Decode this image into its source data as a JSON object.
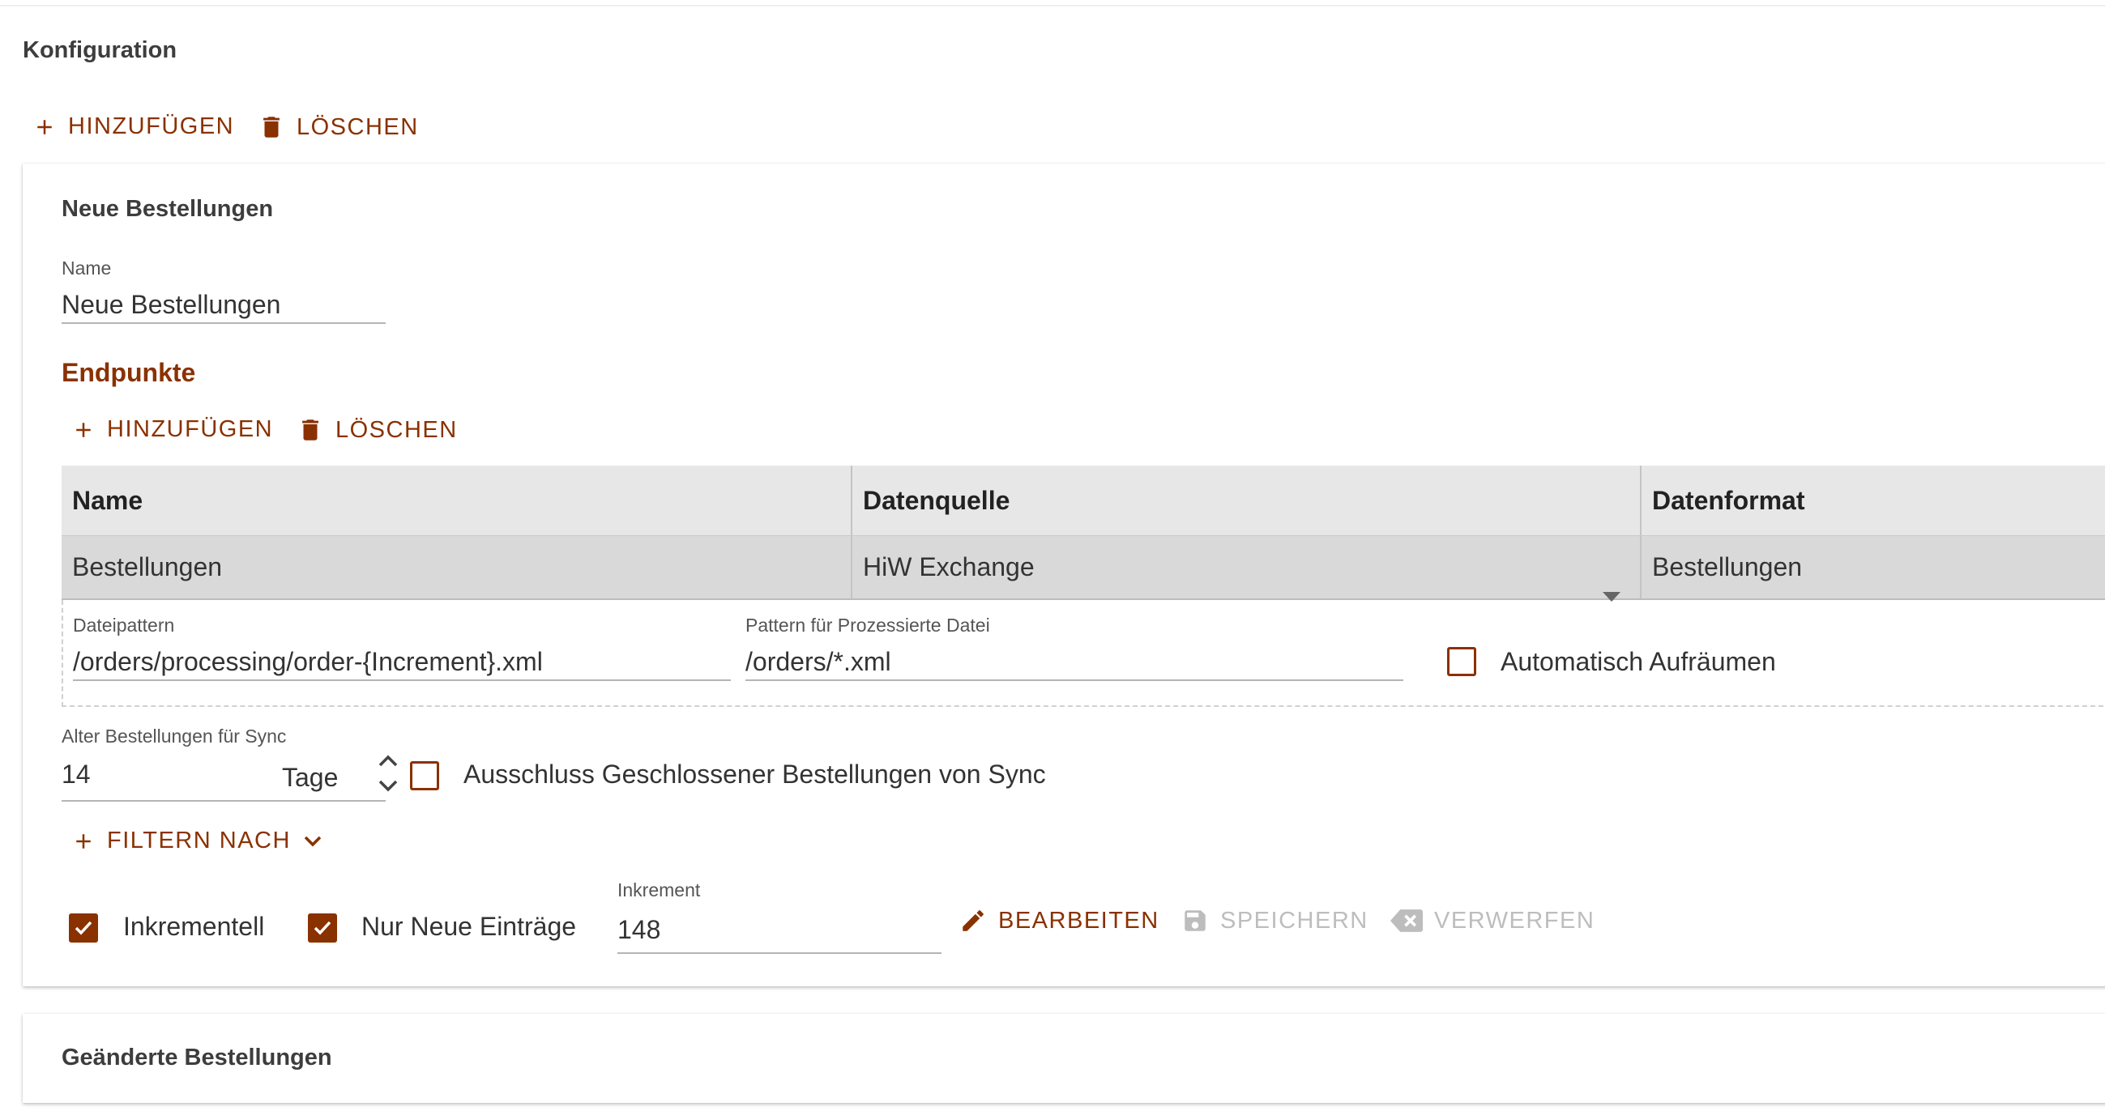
{
  "page": {
    "title": "Konfiguration"
  },
  "toolbar": {
    "add_label": "HINZUFÜGEN",
    "delete_label": "LÖSCHEN"
  },
  "config": {
    "title": "Neue Bestellungen",
    "name_label": "Name",
    "name_value": "Neue Bestellungen",
    "endpoints": {
      "title": "Endpunkte",
      "add_label": "HINZUFÜGEN",
      "delete_label": "LÖSCHEN",
      "columns": [
        "Name",
        "Datenquelle",
        "Datenformat"
      ],
      "rows": [
        {
          "name": "Bestellungen",
          "source": "HiW Exchange",
          "format": "Bestellungen"
        }
      ],
      "detail": {
        "file_pattern_label": "Dateipattern",
        "file_pattern_value": "/orders/processing/order-{Increment}.xml",
        "processed_pattern_label": "Pattern für Prozessierte Datei",
        "processed_pattern_value": "/orders/*.xml",
        "auto_cleanup_label": "Automatisch Aufräumen",
        "auto_cleanup_checked": false
      }
    },
    "sync_age": {
      "label": "Alter Bestellungen für Sync",
      "value": "14",
      "unit": "Tage"
    },
    "exclude_closed": {
      "label": "Ausschluss Geschlossener Bestellungen von Sync",
      "checked": false
    },
    "filter_label": "FILTERN NACH",
    "incremental": {
      "label": "Inkrementell",
      "checked": true
    },
    "only_new": {
      "label": "Nur Neue Einträge",
      "checked": true
    },
    "increment": {
      "label": "Inkrement",
      "value": "148"
    },
    "actions": {
      "edit": "BEARBEITEN",
      "save": "SPEICHERN",
      "discard": "VERWERFEN"
    }
  },
  "config2": {
    "title": "Geänderte Bestellungen"
  },
  "colors": {
    "accent": "#8a3100",
    "disabled": "#bdbdbd",
    "header_bg": "#e7e7e7",
    "row_bg": "#d9d9d9"
  },
  "icons": [
    "plus-icon",
    "trash-icon",
    "dropdown-arrow-icon",
    "chevron-up-icon",
    "chevron-down-icon",
    "pencil-icon",
    "save-icon",
    "backspace-x-icon",
    "check-icon"
  ]
}
